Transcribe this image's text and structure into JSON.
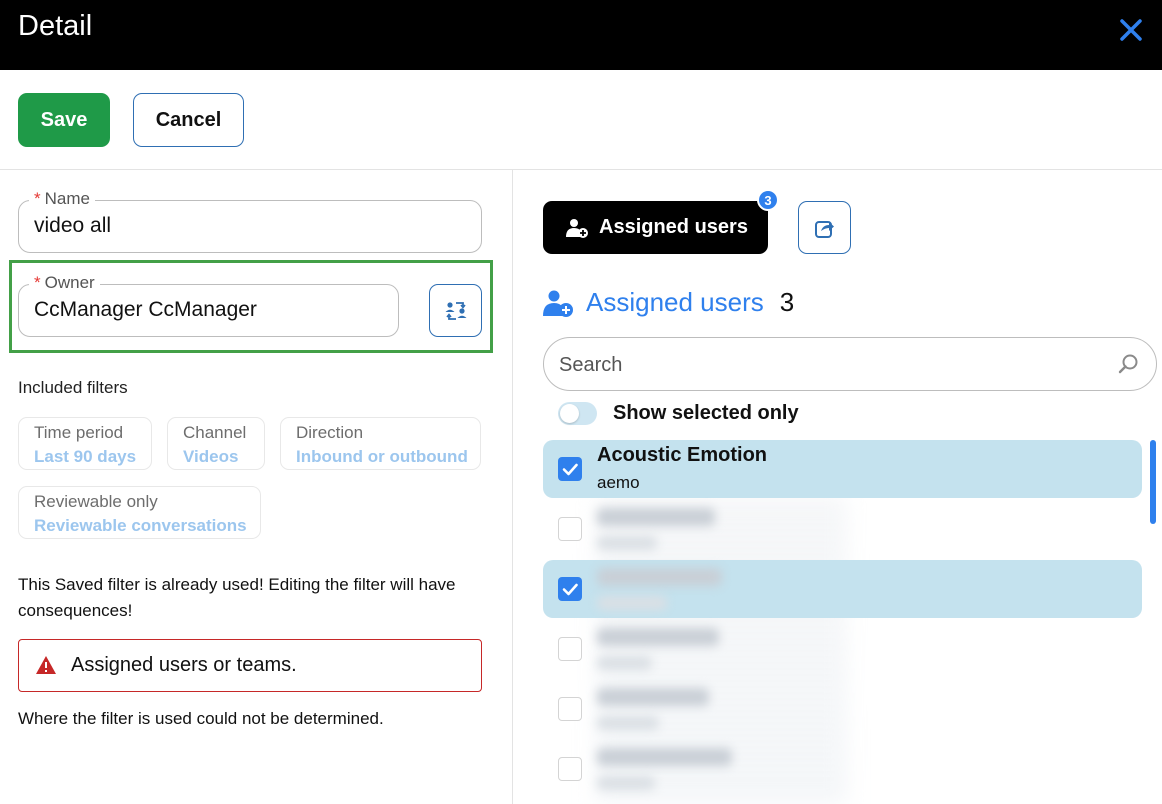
{
  "header": {
    "title": "Detail",
    "close_icon": "close-icon"
  },
  "toolbar": {
    "save_label": "Save",
    "cancel_label": "Cancel"
  },
  "form": {
    "required_mark": "*",
    "name": {
      "label": "Name",
      "value": "video all"
    },
    "owner": {
      "label": "Owner",
      "value": "CcManager CcManager",
      "swap_icon": "swap-users-icon"
    }
  },
  "filters": {
    "label": "Included filters",
    "chips": [
      {
        "key": "Time period",
        "value": "Last 90 days"
      },
      {
        "key": "Channel",
        "value": "Videos"
      },
      {
        "key": "Direction",
        "value": "Inbound or outbound"
      },
      {
        "key": "Reviewable only",
        "value": "Reviewable conversations"
      }
    ]
  },
  "warning": {
    "text": "This Saved filter is already used! Editing the filter will have consequences!",
    "alert_text": "Assigned users or teams.",
    "alert_icon": "warning-triangle-icon",
    "footer_text": "Where the filter is used could not be determined."
  },
  "right": {
    "assigned_button_label": "Assigned users",
    "assigned_badge": "3",
    "share_icon": "share-icon",
    "section_title": "Assigned users",
    "section_count": "3",
    "search_placeholder": "Search",
    "toggle_label": "Show selected only",
    "users": [
      {
        "name": "Acoustic Emotion",
        "username": "aemo",
        "checked": true,
        "blurred": false
      },
      {
        "checked": false,
        "blurred": true
      },
      {
        "checked": true,
        "blurred": true
      },
      {
        "checked": false,
        "blurred": true
      },
      {
        "checked": false,
        "blurred": true
      },
      {
        "checked": false,
        "blurred": true
      }
    ]
  },
  "colors": {
    "save_green": "#1f9a48",
    "accent_blue": "#2f80ed",
    "selected_row": "#c4e2ee",
    "owner_highlight": "#43a047",
    "alert_red": "#c62828"
  }
}
